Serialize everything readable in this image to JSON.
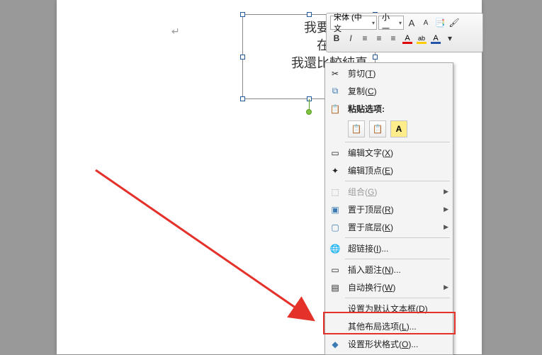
{
  "textbox": {
    "line1": "我要到未来",
    "line2": "在履自针",
    "line3": "我還比較純真"
  },
  "mini_toolbar": {
    "font_name": "宋体 (中文",
    "font_size": "小一",
    "grow": "A",
    "shrink": "A",
    "bold": "B",
    "italic": "I",
    "font_color_letter": "A",
    "highlight_letter": "ab",
    "brush_letter": "A"
  },
  "context_menu": {
    "cut": "剪切(",
    "cut_key": "T",
    "cut_end": ")",
    "copy": "复制(",
    "copy_key": "C",
    "copy_end": ")",
    "paste_heading": "粘贴选项:",
    "edit_text": "编辑文字(",
    "edit_text_key": "X",
    "edit_text_end": ")",
    "edit_points": "编辑顶点(",
    "edit_points_key": "E",
    "edit_points_end": ")",
    "group": "组合(",
    "group_key": "G",
    "group_end": ")",
    "bring_front": "置于顶层(",
    "bring_front_key": "R",
    "bring_front_end": ")",
    "send_back": "置于底层(",
    "send_back_key": "K",
    "send_back_end": ")",
    "hyperlink": "超链接(",
    "hyperlink_key": "I",
    "hyperlink_end": ")...",
    "caption": "插入题注(",
    "caption_key": "N",
    "caption_end": ")...",
    "wrap": "自动换行(",
    "wrap_key": "W",
    "wrap_end": ")",
    "default_tb": "设置为默认文本框(",
    "default_tb_key": "D",
    "default_tb_end": ")",
    "layout_opt": "其他布局选项(",
    "layout_opt_key": "L",
    "layout_opt_end": ")...",
    "format_shape": "设置形状格式(",
    "format_shape_key": "O",
    "format_shape_end": ")..."
  }
}
